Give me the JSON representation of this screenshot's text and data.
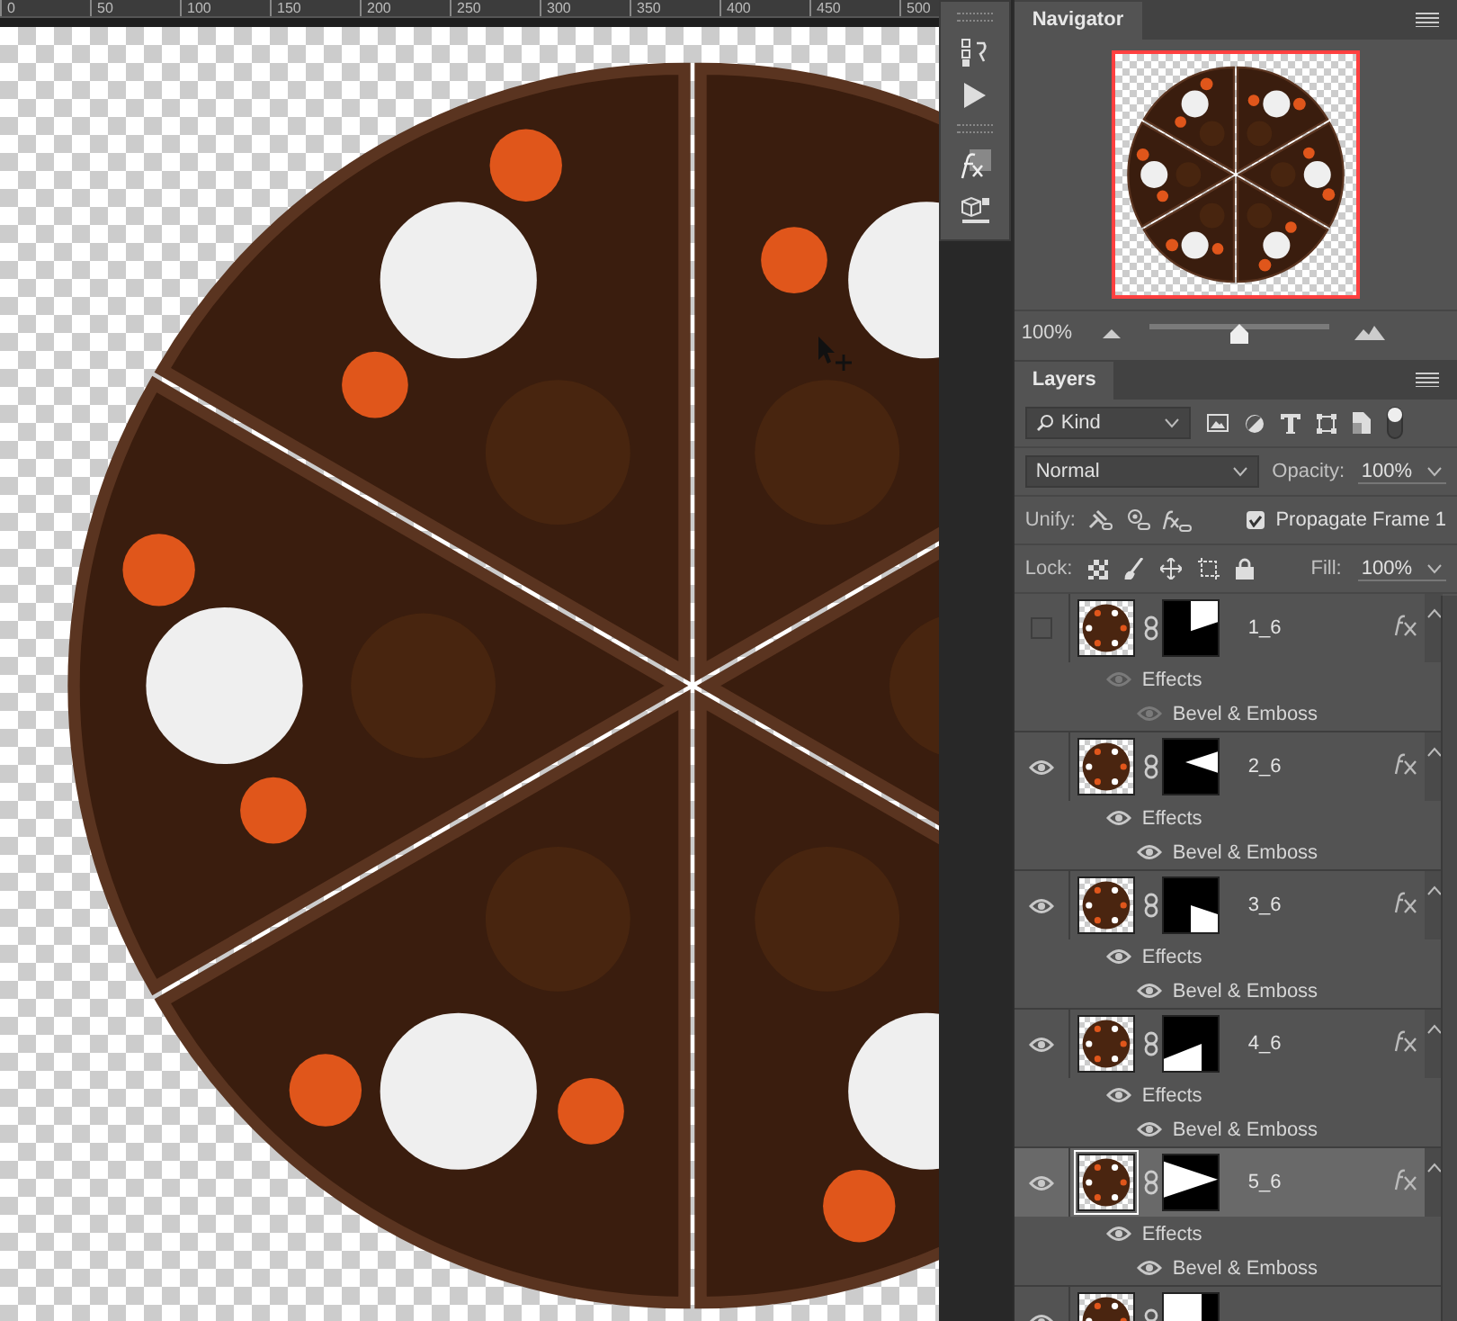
{
  "ruler": {
    "ticks": [
      "0",
      "50",
      "100",
      "150",
      "200",
      "250",
      "300",
      "350",
      "400",
      "450",
      "500"
    ]
  },
  "navigator": {
    "tab": "Navigator",
    "zoom": "100%",
    "level": 0.5
  },
  "layers_panel": {
    "tab": "Layers",
    "filter": "Kind",
    "blend_mode": "Normal",
    "opacity_label": "Opacity:",
    "opacity": "100%",
    "unify_label": "Unify:",
    "propagate": {
      "label": "Propagate Frame 1",
      "checked": true
    },
    "lock_label": "Lock:",
    "fill_label": "Fill:",
    "fill": "100%",
    "layers": [
      {
        "name": "1_6",
        "visible": false,
        "selected": false,
        "effects": [
          "Effects",
          "Bevel & Emboss"
        ]
      },
      {
        "name": "2_6",
        "visible": true,
        "selected": false,
        "effects": [
          "Effects",
          "Bevel & Emboss"
        ]
      },
      {
        "name": "3_6",
        "visible": true,
        "selected": false,
        "effects": [
          "Effects",
          "Bevel & Emboss"
        ]
      },
      {
        "name": "4_6",
        "visible": true,
        "selected": false,
        "effects": [
          "Effects",
          "Bevel & Emboss"
        ]
      },
      {
        "name": "5_6",
        "visible": true,
        "selected": true,
        "effects": [
          "Effects",
          "Bevel & Emboss"
        ]
      },
      {
        "visible": true,
        "selected": false
      }
    ]
  }
}
